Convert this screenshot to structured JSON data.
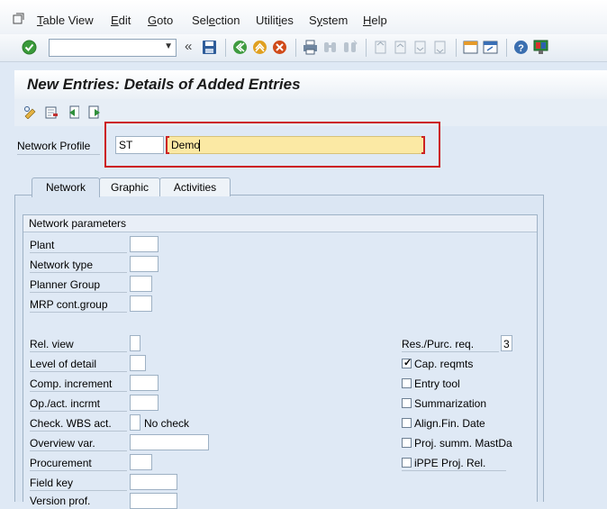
{
  "menu": {
    "items": [
      {
        "pre": "",
        "u": "T",
        "post": "able View"
      },
      {
        "pre": "",
        "u": "E",
        "post": "dit"
      },
      {
        "pre": "",
        "u": "G",
        "post": "oto"
      },
      {
        "pre": "Sel",
        "u": "e",
        "post": "ction"
      },
      {
        "pre": "Utilit",
        "u": "i",
        "post": "es"
      },
      {
        "pre": "S",
        "u": "y",
        "post": "stem"
      },
      {
        "pre": "",
        "u": "H",
        "post": "elp"
      }
    ]
  },
  "toolbar": {
    "command_field_value": "",
    "history_glyph": "«"
  },
  "screen": {
    "title": "New Entries: Details of Added Entries"
  },
  "key": {
    "network_profile_label": "Network Profile",
    "network_profile_value": "ST",
    "description_value": "Demo"
  },
  "tabs": [
    {
      "label": "Network",
      "active": true
    },
    {
      "label": "Graphic",
      "active": false
    },
    {
      "label": "Activities",
      "active": false
    }
  ],
  "group": {
    "title": "Network parameters",
    "fields_left": [
      {
        "label": "Plant",
        "value": ""
      },
      {
        "label": "Network type",
        "value": ""
      },
      {
        "label": "Planner Group",
        "value": ""
      },
      {
        "label": "MRP cont.group",
        "value": ""
      },
      {
        "label": "Rel. view",
        "value": ""
      },
      {
        "label": "Level of detail",
        "value": ""
      },
      {
        "label": "Comp. increment",
        "value": ""
      },
      {
        "label": "Op./act. incrmt",
        "value": ""
      },
      {
        "label": "Check. WBS act.",
        "value": "",
        "note": "No check"
      },
      {
        "label": "Overview var.",
        "value": ""
      },
      {
        "label": "Procurement",
        "value": ""
      },
      {
        "label": "Field key",
        "value": ""
      },
      {
        "label": "Version prof.",
        "value": ""
      }
    ],
    "res_purc_req_label": "Res./Purc. req.",
    "res_purc_req_value": "3",
    "checkboxes": [
      {
        "label": "Cap. reqmts",
        "checked": true
      },
      {
        "label": "Entry tool",
        "checked": false
      },
      {
        "label": "Summarization",
        "checked": false
      },
      {
        "label": "Align.Fin. Date",
        "checked": false
      },
      {
        "label": "Proj. summ. MastDa",
        "checked": false
      },
      {
        "label": "iPPE Proj. Rel.",
        "checked": false
      }
    ]
  },
  "icons": {
    "colors": {
      "enter": "#3a9a3a",
      "save": "#2f5d9a",
      "back": "#3f9b3f",
      "exit": "#e0a020",
      "cancel": "#d04a1a",
      "help": "#3b6fb0"
    }
  }
}
